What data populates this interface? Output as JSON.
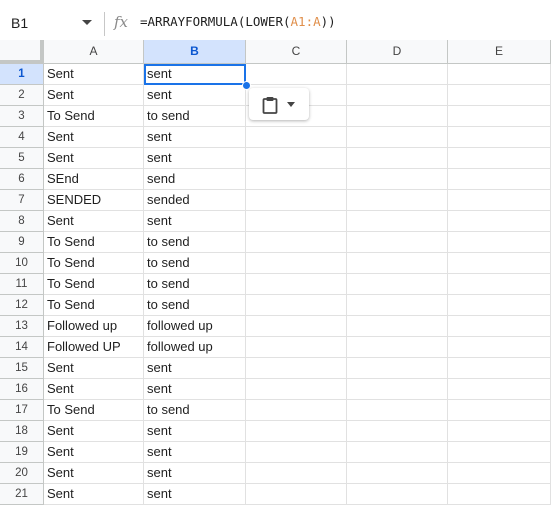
{
  "name_box": "B1",
  "formula_bar": {
    "fx_label": "fx",
    "formula_prefix": "=ARRAYFORMULA(LOWER(",
    "formula_range": "A1:A",
    "formula_suffix": "))"
  },
  "columns": [
    "A",
    "B",
    "C",
    "D",
    "E"
  ],
  "rows": [
    {
      "n": "1",
      "a": "Sent",
      "b": "sent"
    },
    {
      "n": "2",
      "a": "Sent",
      "b": "sent"
    },
    {
      "n": "3",
      "a": "To Send",
      "b": "to send"
    },
    {
      "n": "4",
      "a": "Sent",
      "b": "sent"
    },
    {
      "n": "5",
      "a": "Sent",
      "b": "sent"
    },
    {
      "n": "6",
      "a": "SEnd",
      "b": "send"
    },
    {
      "n": "7",
      "a": "SENDED",
      "b": "sended"
    },
    {
      "n": "8",
      "a": "Sent",
      "b": "sent"
    },
    {
      "n": "9",
      "a": "To Send",
      "b": "to send"
    },
    {
      "n": "10",
      "a": "To Send",
      "b": "to send"
    },
    {
      "n": "11",
      "a": "To Send",
      "b": "to send"
    },
    {
      "n": "12",
      "a": "To Send",
      "b": "to send"
    },
    {
      "n": "13",
      "a": "Followed up",
      "b": "followed up"
    },
    {
      "n": "14",
      "a": "Followed UP",
      "b": "followed up"
    },
    {
      "n": "15",
      "a": "Sent",
      "b": "sent"
    },
    {
      "n": "16",
      "a": "Sent",
      "b": "sent"
    },
    {
      "n": "17",
      "a": "To Send",
      "b": "to send"
    },
    {
      "n": "18",
      "a": "Sent",
      "b": "sent"
    },
    {
      "n": "19",
      "a": "Sent",
      "b": "sent"
    },
    {
      "n": "20",
      "a": "Sent",
      "b": "sent"
    },
    {
      "n": "21",
      "a": "Sent",
      "b": "sent"
    }
  ],
  "selected": {
    "column": "B",
    "row": "1"
  },
  "paste_chip": {
    "icon": "clipboard-icon"
  },
  "colors": {
    "accent": "#1a73e8",
    "header_selected": "#d3e3fd",
    "formula_range": "#e08f4b"
  }
}
